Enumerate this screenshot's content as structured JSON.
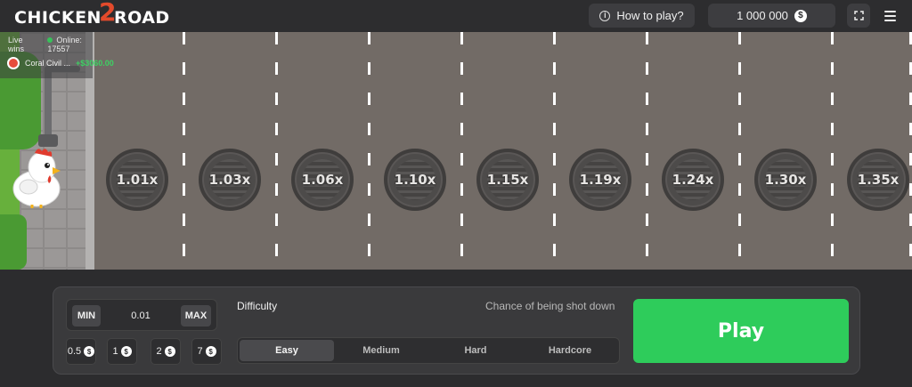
{
  "header": {
    "logo_part1": "CHICKEN",
    "logo_part2": "2",
    "logo_part3": "ROAD",
    "how_to_play": "How to play?",
    "balance": "1 000 000",
    "currency_symbol": "$"
  },
  "live": {
    "label": "Live wins",
    "online": "Online: 17557",
    "winner_name": "Coral Civil ...",
    "winner_amount": "+$3060.00"
  },
  "lanes": {
    "multipliers": [
      "1.01x",
      "1.03x",
      "1.06x",
      "1.10x",
      "1.15x",
      "1.19x",
      "1.24x",
      "1.30x",
      "1.35x"
    ]
  },
  "controls": {
    "min_label": "MIN",
    "max_label": "MAX",
    "bet_value": "0.01",
    "chips": [
      "0.5",
      "1",
      "2",
      "7"
    ],
    "difficulty_label": "Difficulty",
    "chance_label": "Chance of being shot down",
    "difficulties": [
      "Easy",
      "Medium",
      "Hard",
      "Hardcore"
    ],
    "selected_difficulty": "Easy",
    "play_label": "Play"
  },
  "colors": {
    "accent_green": "#2ecc5b",
    "logo_red": "#e34a2b",
    "road": "#726b66"
  }
}
